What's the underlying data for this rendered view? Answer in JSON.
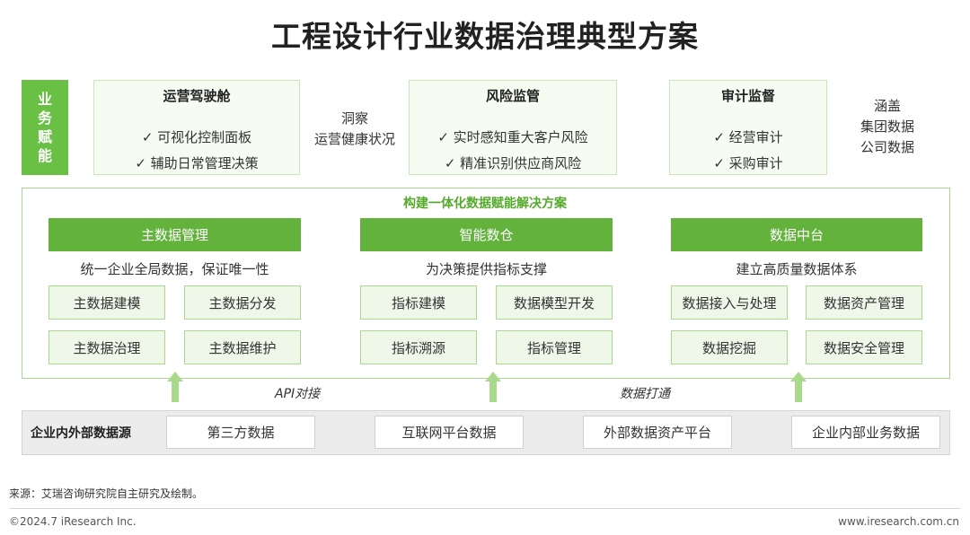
{
  "title": "工程设计行业数据治理典型方案",
  "side_label": "业务赋能",
  "top_boxes": [
    {
      "title": "运营驾驶舱",
      "items": [
        "可视化控制面板",
        "辅助日常管理决策"
      ]
    },
    {
      "title": "风险监管",
      "items": [
        "实时感知重大客户风险",
        "精准识别供应商风险"
      ]
    },
    {
      "title": "审计监督",
      "items": [
        "经营审计",
        "采购审计"
      ]
    }
  ],
  "check": "✓",
  "notes": [
    [
      "洞察",
      "运营健康状况"
    ],
    [
      "涵盖",
      "集团数据",
      "公司数据"
    ]
  ],
  "middle_title": "构建一体化数据赋能解决方案",
  "modules": [
    {
      "header": "主数据管理",
      "desc": "统一企业全局数据，保证唯一性",
      "cells": [
        "主数据建模",
        "主数据分发",
        "主数据治理",
        "主数据维护"
      ]
    },
    {
      "header": "智能数仓",
      "desc": "为决策提供指标支撑",
      "cells": [
        "指标建模",
        "数据模型开发",
        "指标溯源",
        "指标管理"
      ]
    },
    {
      "header": "数据中台",
      "desc": "建立高质量数据体系",
      "cells": [
        "数据接入与处理",
        "数据资产管理",
        "数据挖掘",
        "数据安全管理"
      ]
    }
  ],
  "arrow_labels": [
    "API对接",
    "数据打通"
  ],
  "sources": {
    "label": "企业内外部数据源",
    "items": [
      "第三方数据",
      "互联网平台数据",
      "外部数据资产平台",
      "企业内部业务数据"
    ]
  },
  "source_note": "来源：艾瑞咨询研究院自主研究及绘制。",
  "footer_left": "©2024.7 iResearch Inc.",
  "footer_right": "www.iresearch.com.cn",
  "colors": {
    "accent": "#62b23b",
    "light": "#eef7e8",
    "border": "#a9d98f"
  }
}
